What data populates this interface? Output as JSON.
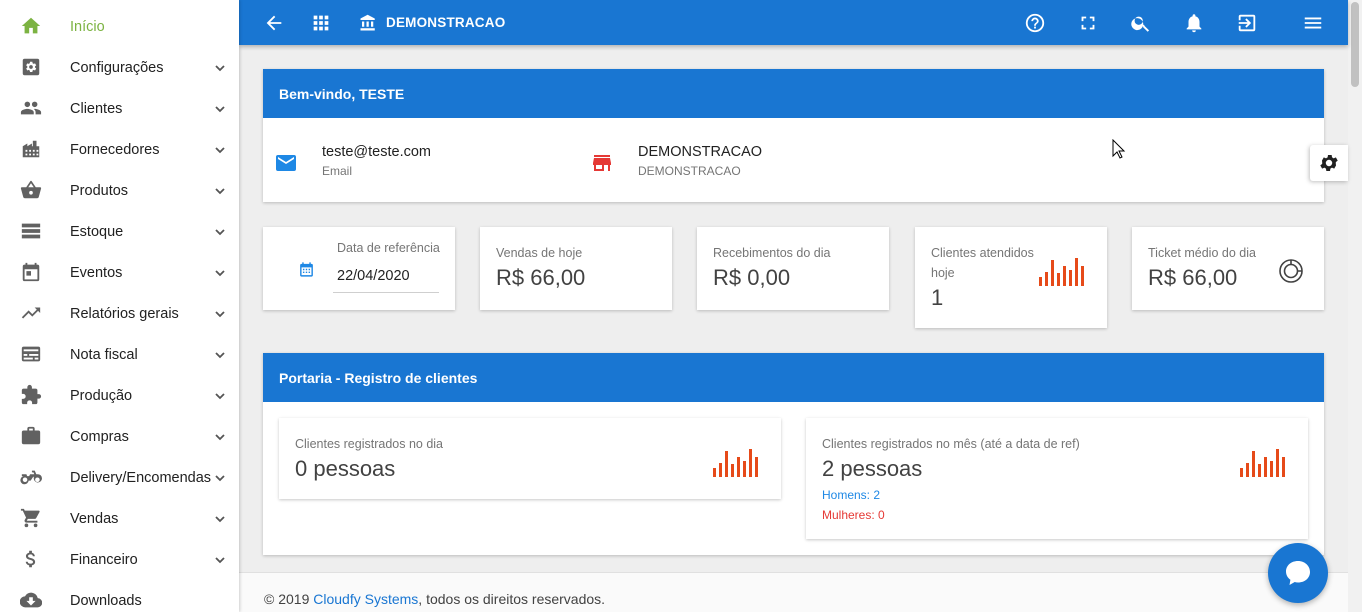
{
  "sidebar": {
    "items": [
      {
        "label": "Início",
        "icon": "home-icon"
      },
      {
        "label": "Configurações",
        "icon": "settings-box-icon"
      },
      {
        "label": "Clientes",
        "icon": "people-icon"
      },
      {
        "label": "Fornecedores",
        "icon": "buildings-icon"
      },
      {
        "label": "Produtos",
        "icon": "basket-icon"
      },
      {
        "label": "Estoque",
        "icon": "list-icon"
      },
      {
        "label": "Eventos",
        "icon": "calendar-icon"
      },
      {
        "label": "Relatórios gerais",
        "icon": "trending-up-icon"
      },
      {
        "label": "Nota fiscal",
        "icon": "invoice-icon"
      },
      {
        "label": "Produção",
        "icon": "puzzle-icon"
      },
      {
        "label": "Compras",
        "icon": "briefcase-icon"
      },
      {
        "label": "Delivery/Encomendas",
        "icon": "motorcycle-icon"
      },
      {
        "label": "Vendas",
        "icon": "cart-icon"
      },
      {
        "label": "Financeiro",
        "icon": "dollar-icon"
      },
      {
        "label": "Downloads",
        "icon": "cloud-download-icon"
      }
    ]
  },
  "topbar": {
    "company": "DEMONSTRACAO"
  },
  "welcome": {
    "title": "Bem-vindo, TESTE",
    "email_value": "teste@teste.com",
    "email_label": "Email",
    "store_value": "DEMONSTRACAO",
    "store_label": "DEMONSTRACAO"
  },
  "stats": {
    "date_label": "Data de referência",
    "date_value": "22/04/2020",
    "sales_label": "Vendas de hoje",
    "sales_value": "R$ 66,00",
    "receipts_label": "Recebimentos do dia",
    "receipts_value": "R$ 0,00",
    "clients_label": "Clientes atendidos hoje",
    "clients_value": "1",
    "ticket_label": "Ticket médio do dia",
    "ticket_value": "R$ 66,00"
  },
  "portaria": {
    "title": "Portaria - Registro de clientes",
    "day_label": "Clientes registrados no dia",
    "day_value": "0 pessoas",
    "month_label": "Clientes registrados no mês (até a data de ref)",
    "month_value": "2 pessoas",
    "men": "Homens: 2",
    "women": "Mulheres: 0"
  },
  "footer": {
    "prefix": "© 2019 ",
    "link": "Cloudfy Systems",
    "suffix": ", todos os direitos reservados."
  },
  "colors": {
    "primary": "#1976d2",
    "active": "#7cb342",
    "bars": "#e64a19",
    "men": "#1e88e5",
    "women": "#e53935"
  }
}
